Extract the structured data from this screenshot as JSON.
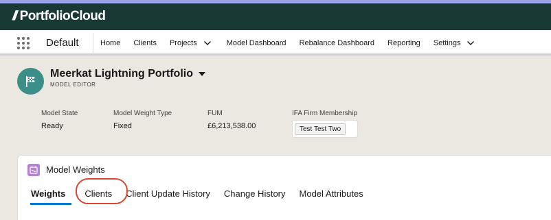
{
  "brand": {
    "logo_prefix": "//",
    "logo_text": "PortfolioCloud"
  },
  "app": {
    "name": "Default"
  },
  "nav": {
    "items": [
      {
        "label": "Home",
        "has_dropdown": false
      },
      {
        "label": "Clients",
        "has_dropdown": false
      },
      {
        "label": "Projects",
        "has_dropdown": true
      },
      {
        "label": "Model Dashboard",
        "has_dropdown": false
      },
      {
        "label": "Rebalance Dashboard",
        "has_dropdown": false
      },
      {
        "label": "Reporting",
        "has_dropdown": false
      },
      {
        "label": "Settings",
        "has_dropdown": true
      }
    ]
  },
  "record": {
    "icon": "flag-icon",
    "title": "Meerkat Lightning Portfolio",
    "subtitle": "MODEL EDITOR",
    "fields": [
      {
        "label": "Model State",
        "value": "Ready"
      },
      {
        "label": "Model Weight Type",
        "value": "Fixed"
      },
      {
        "label": "FUM",
        "value": "£6,213,538.00"
      },
      {
        "label": "IFA Firm Membership",
        "value": "Test Test Two"
      }
    ]
  },
  "card": {
    "icon": "calendar-icon",
    "title": "Model Weights",
    "tabs": [
      {
        "label": "Weights",
        "active": true
      },
      {
        "label": "Clients",
        "active": false,
        "highlighted": true
      },
      {
        "label": "Client Update History",
        "active": false
      },
      {
        "label": "Change History",
        "active": false
      },
      {
        "label": "Model Attributes",
        "active": false
      }
    ]
  },
  "colors": {
    "brand_bar": "#193a34",
    "avatar": "#3b8f88",
    "active_tab": "#0176d3",
    "highlight": "#d9472f",
    "card_icon": "#b781d3"
  }
}
